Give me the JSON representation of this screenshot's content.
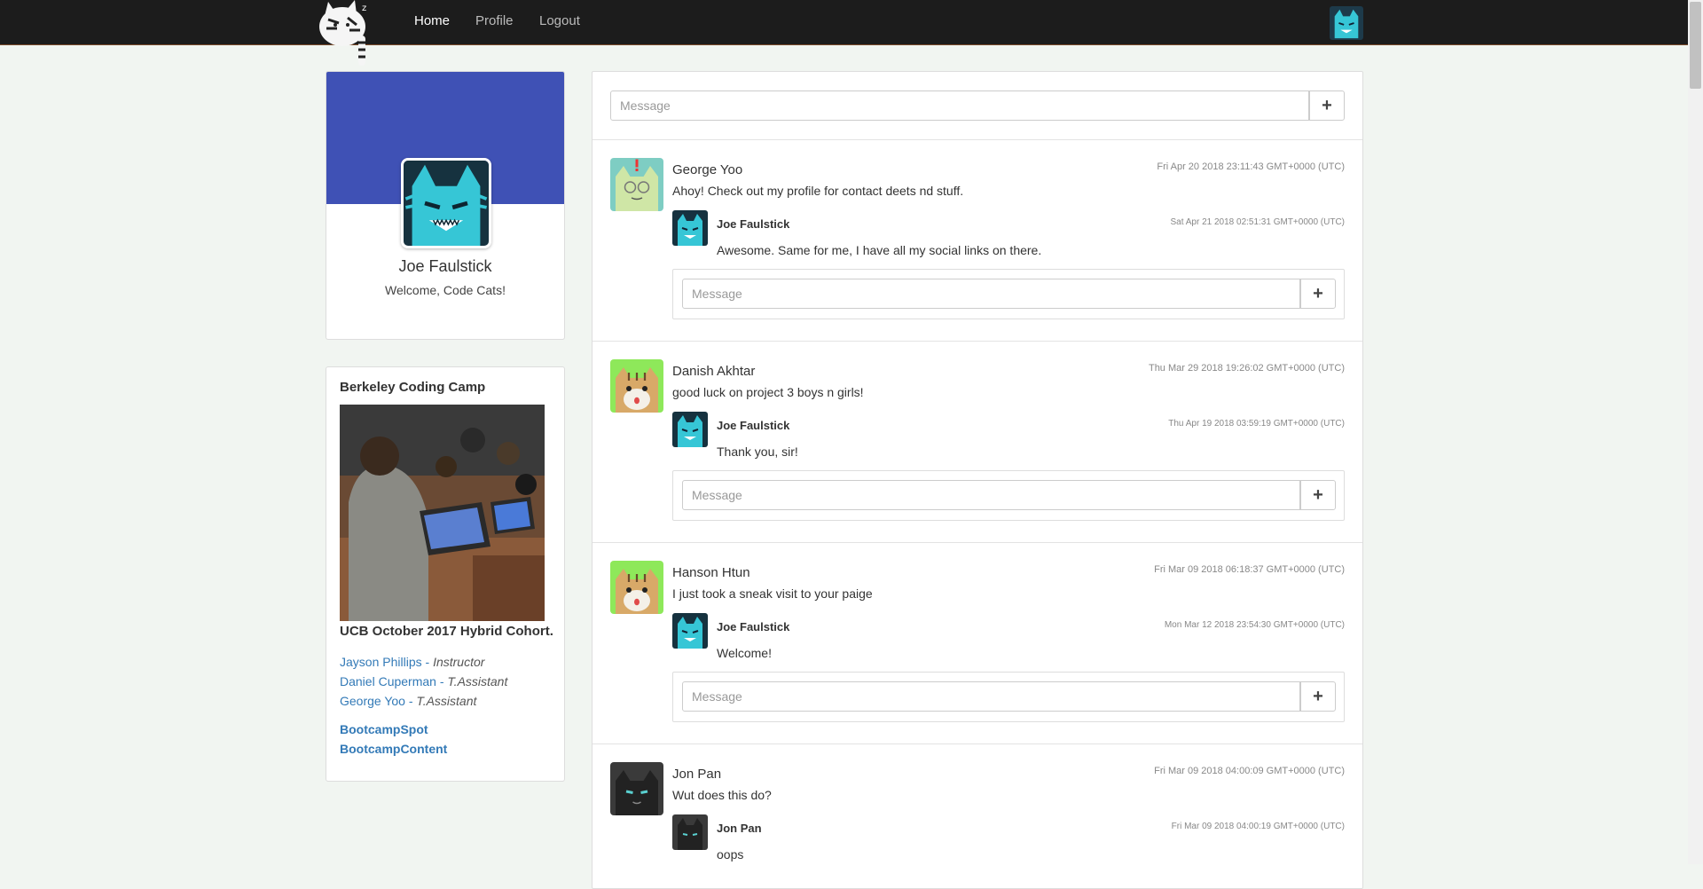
{
  "nav": {
    "links": [
      {
        "label": "Home",
        "active": true
      },
      {
        "label": "Profile",
        "active": false
      },
      {
        "label": "Logout",
        "active": false
      }
    ],
    "logo_icon": "cat-logo-icon",
    "user_avatar_icon": "cat-avatar-icon"
  },
  "profile": {
    "name": "Joe Faulstick",
    "welcome": "Welcome, Code Cats!",
    "banner_color": "#3f51b5"
  },
  "cohort": {
    "title": "Berkeley Coding Camp",
    "caption": "UCB October 2017 Hybrid Cohort.",
    "staff": [
      {
        "name": "Jayson Phillips",
        "role": "Instructor"
      },
      {
        "name": "Daniel Cuperman",
        "role": "T.Assistant"
      },
      {
        "name": "George Yoo",
        "role": "T.Assistant"
      }
    ],
    "links": [
      "BootcampSpot",
      "BootcampContent"
    ]
  },
  "composer": {
    "placeholder": "Message",
    "button": "+"
  },
  "posts": [
    {
      "author": "George Yoo",
      "time": "Fri Apr 20 2018 23:11:43 GMT+0000 (UTC)",
      "text": "Ahoy! Check out my profile for contact deets nd stuff.",
      "reply": {
        "author": "Joe Faulstick",
        "time": "Sat Apr 21 2018 02:51:31 GMT+0000 (UTC)",
        "text": "Awesome. Same for me, I have all my social links on there."
      },
      "reply_placeholder": "Message"
    },
    {
      "author": "Danish Akhtar",
      "time": "Thu Mar 29 2018 19:26:02 GMT+0000 (UTC)",
      "text": "good luck on project 3 boys n girls!",
      "reply": {
        "author": "Joe Faulstick",
        "time": "Thu Apr 19 2018 03:59:19 GMT+0000 (UTC)",
        "text": "Thank you, sir!"
      },
      "reply_placeholder": "Message"
    },
    {
      "author": "Hanson Htun",
      "time": "Fri Mar 09 2018 06:18:37 GMT+0000 (UTC)",
      "text": "I just took a sneak visit to your paige",
      "reply": {
        "author": "Joe Faulstick",
        "time": "Mon Mar 12 2018 23:54:30 GMT+0000 (UTC)",
        "text": "Welcome!"
      },
      "reply_placeholder": "Message"
    },
    {
      "author": "Jon Pan",
      "time": "Fri Mar 09 2018 04:00:09 GMT+0000 (UTC)",
      "text": "Wut does this do?",
      "reply": {
        "author": "Jon Pan",
        "time": "Fri Mar 09 2018 04:00:19 GMT+0000 (UTC)",
        "text": "oops"
      },
      "reply_placeholder": "Message"
    }
  ]
}
